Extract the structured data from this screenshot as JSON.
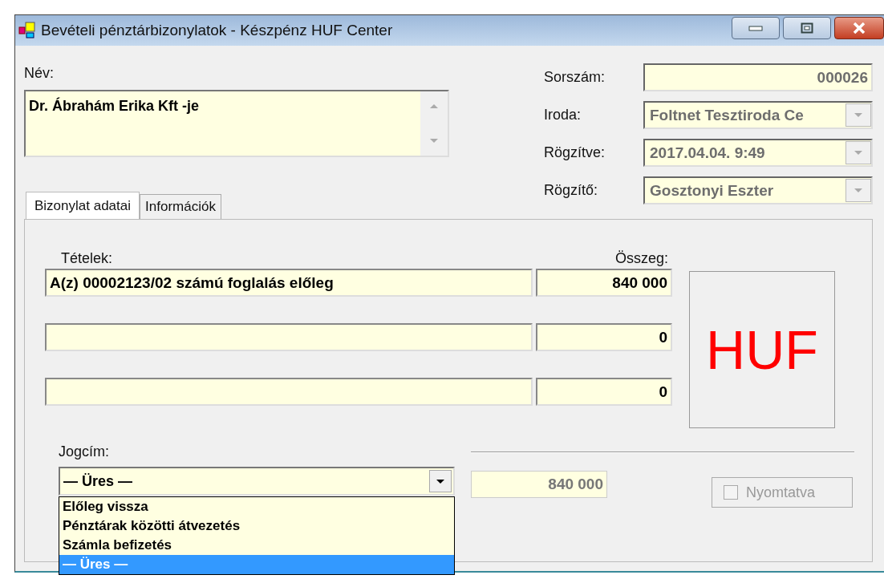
{
  "window": {
    "title": "Bevételi pénztárbizonylatok - Készpénz HUF Center"
  },
  "name": {
    "label": "Név:",
    "value": "Dr. Ábrahám Erika Kft -je"
  },
  "fields": [
    {
      "label": "Sorszám:",
      "value": "000026",
      "kind": "text"
    },
    {
      "label": "Iroda:",
      "value": "Foltnet Tesztiroda Ce",
      "kind": "combo"
    },
    {
      "label": "Rögzítve:",
      "value": "2017.04.04. 9:49",
      "kind": "combo"
    },
    {
      "label": "Rögzítő:",
      "value": "Gosztonyi Eszter",
      "kind": "combo"
    }
  ],
  "tabs": [
    {
      "label": "Bizonylat adatai",
      "selected": true
    },
    {
      "label": "Információk",
      "selected": false
    }
  ],
  "items": {
    "label": "Tételek:",
    "amount_label": "Összeg:",
    "rows": [
      {
        "text": "A(z) 00002123/02 számú foglalás előleg",
        "amount": "840 000"
      },
      {
        "amount": "0"
      },
      {
        "amount": "0"
      }
    ]
  },
  "currency": "HUF",
  "jogcim": {
    "label": "Jogcím:",
    "value": "— Üres —",
    "options": [
      {
        "label": "Előleg vissza",
        "selected": false
      },
      {
        "label": "Pénztárak közötti átvezetés",
        "selected": false
      },
      {
        "label": "Számla befizetés",
        "selected": false
      },
      {
        "label": "— Üres —",
        "selected": true
      }
    ]
  },
  "total": "840 000",
  "printed": {
    "label": "Nyomtatva",
    "checked": false,
    "disabled": true
  }
}
